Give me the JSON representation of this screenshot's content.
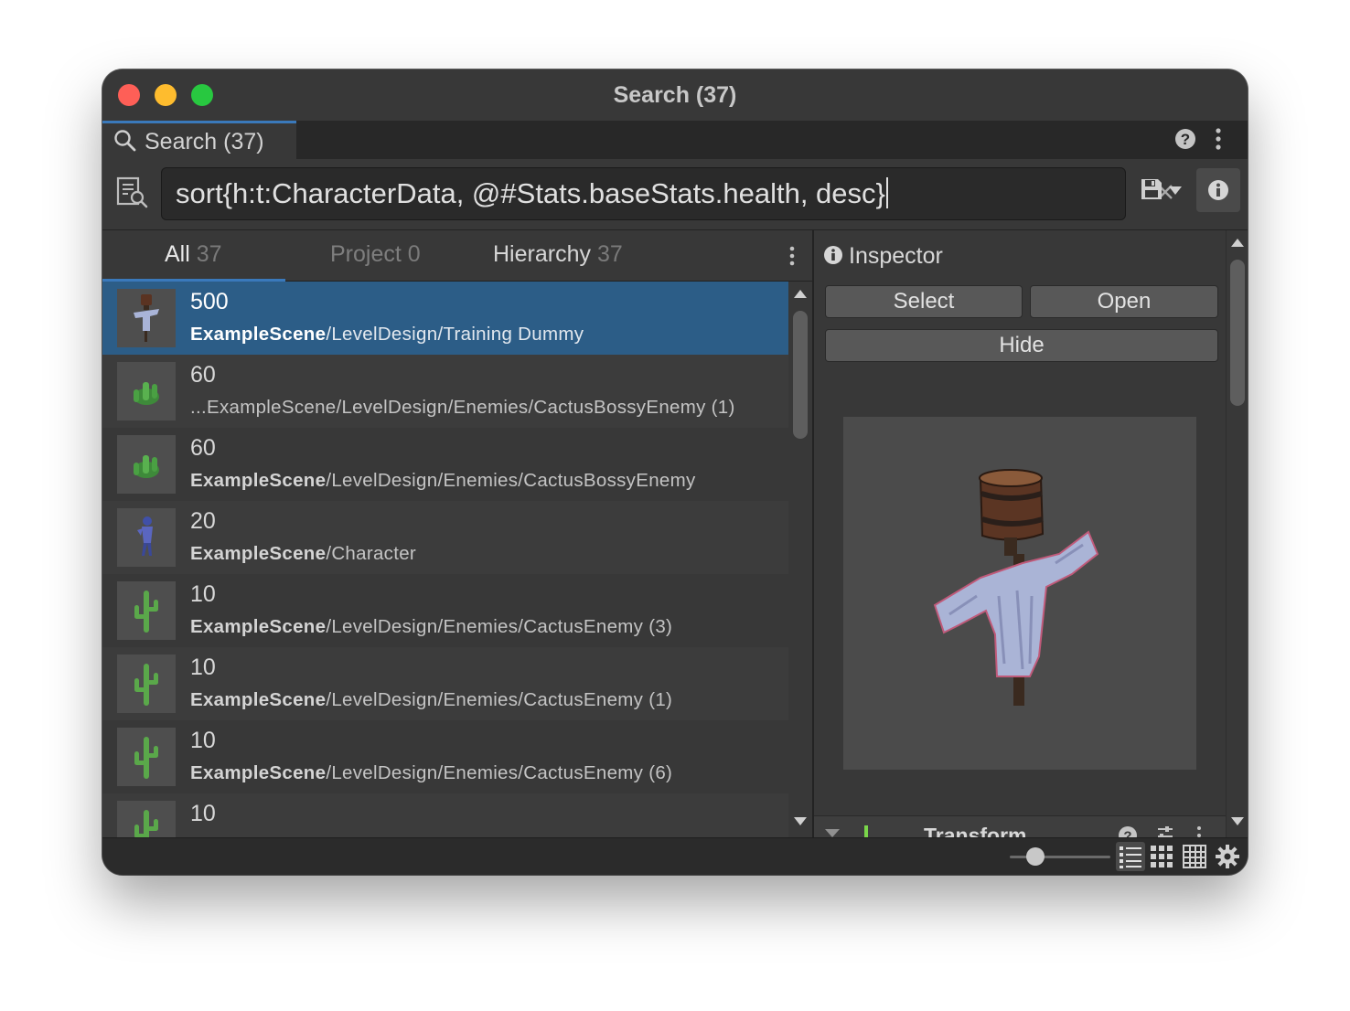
{
  "window": {
    "title": "Search (37)"
  },
  "tab": {
    "label": "Search (37)"
  },
  "search": {
    "query": "sort{h:t:CharacterData, @#Stats.baseStats.health, desc}"
  },
  "filters": [
    {
      "label": "All",
      "count": "37"
    },
    {
      "label": "Project",
      "count": "0"
    },
    {
      "label": "Hierarchy",
      "count": "37"
    }
  ],
  "results": [
    {
      "value": "500",
      "path_bold": "ExampleScene",
      "path_rest": "/LevelDesign/Training Dummy",
      "icon": "scarecrow-icon"
    },
    {
      "value": "60",
      "path_bold": "",
      "path_rest": "...ExampleScene/LevelDesign/Enemies/CactusBossyEnemy (1)",
      "icon": "cactus-bossy-icon"
    },
    {
      "value": "60",
      "path_bold": "ExampleScene",
      "path_rest": "/LevelDesign/Enemies/CactusBossyEnemy",
      "icon": "cactus-bossy-icon"
    },
    {
      "value": "20",
      "path_bold": "ExampleScene",
      "path_rest": "/Character",
      "icon": "character-icon"
    },
    {
      "value": "10",
      "path_bold": "ExampleScene",
      "path_rest": "/LevelDesign/Enemies/CactusEnemy (3)",
      "icon": "cactus-icon"
    },
    {
      "value": "10",
      "path_bold": "ExampleScene",
      "path_rest": "/LevelDesign/Enemies/CactusEnemy (1)",
      "icon": "cactus-icon"
    },
    {
      "value": "10",
      "path_bold": "ExampleScene",
      "path_rest": "/LevelDesign/Enemies/CactusEnemy (6)",
      "icon": "cactus-icon"
    },
    {
      "value": "10",
      "path_bold": "",
      "path_rest": "",
      "icon": "cactus-icon"
    }
  ],
  "inspector": {
    "title": "Inspector",
    "select_label": "Select",
    "open_label": "Open",
    "hide_label": "Hide",
    "component_label": "Transform"
  },
  "colors": {
    "accent": "#3a79bb",
    "selection": "#2c5d87",
    "window_bg": "#383838"
  }
}
